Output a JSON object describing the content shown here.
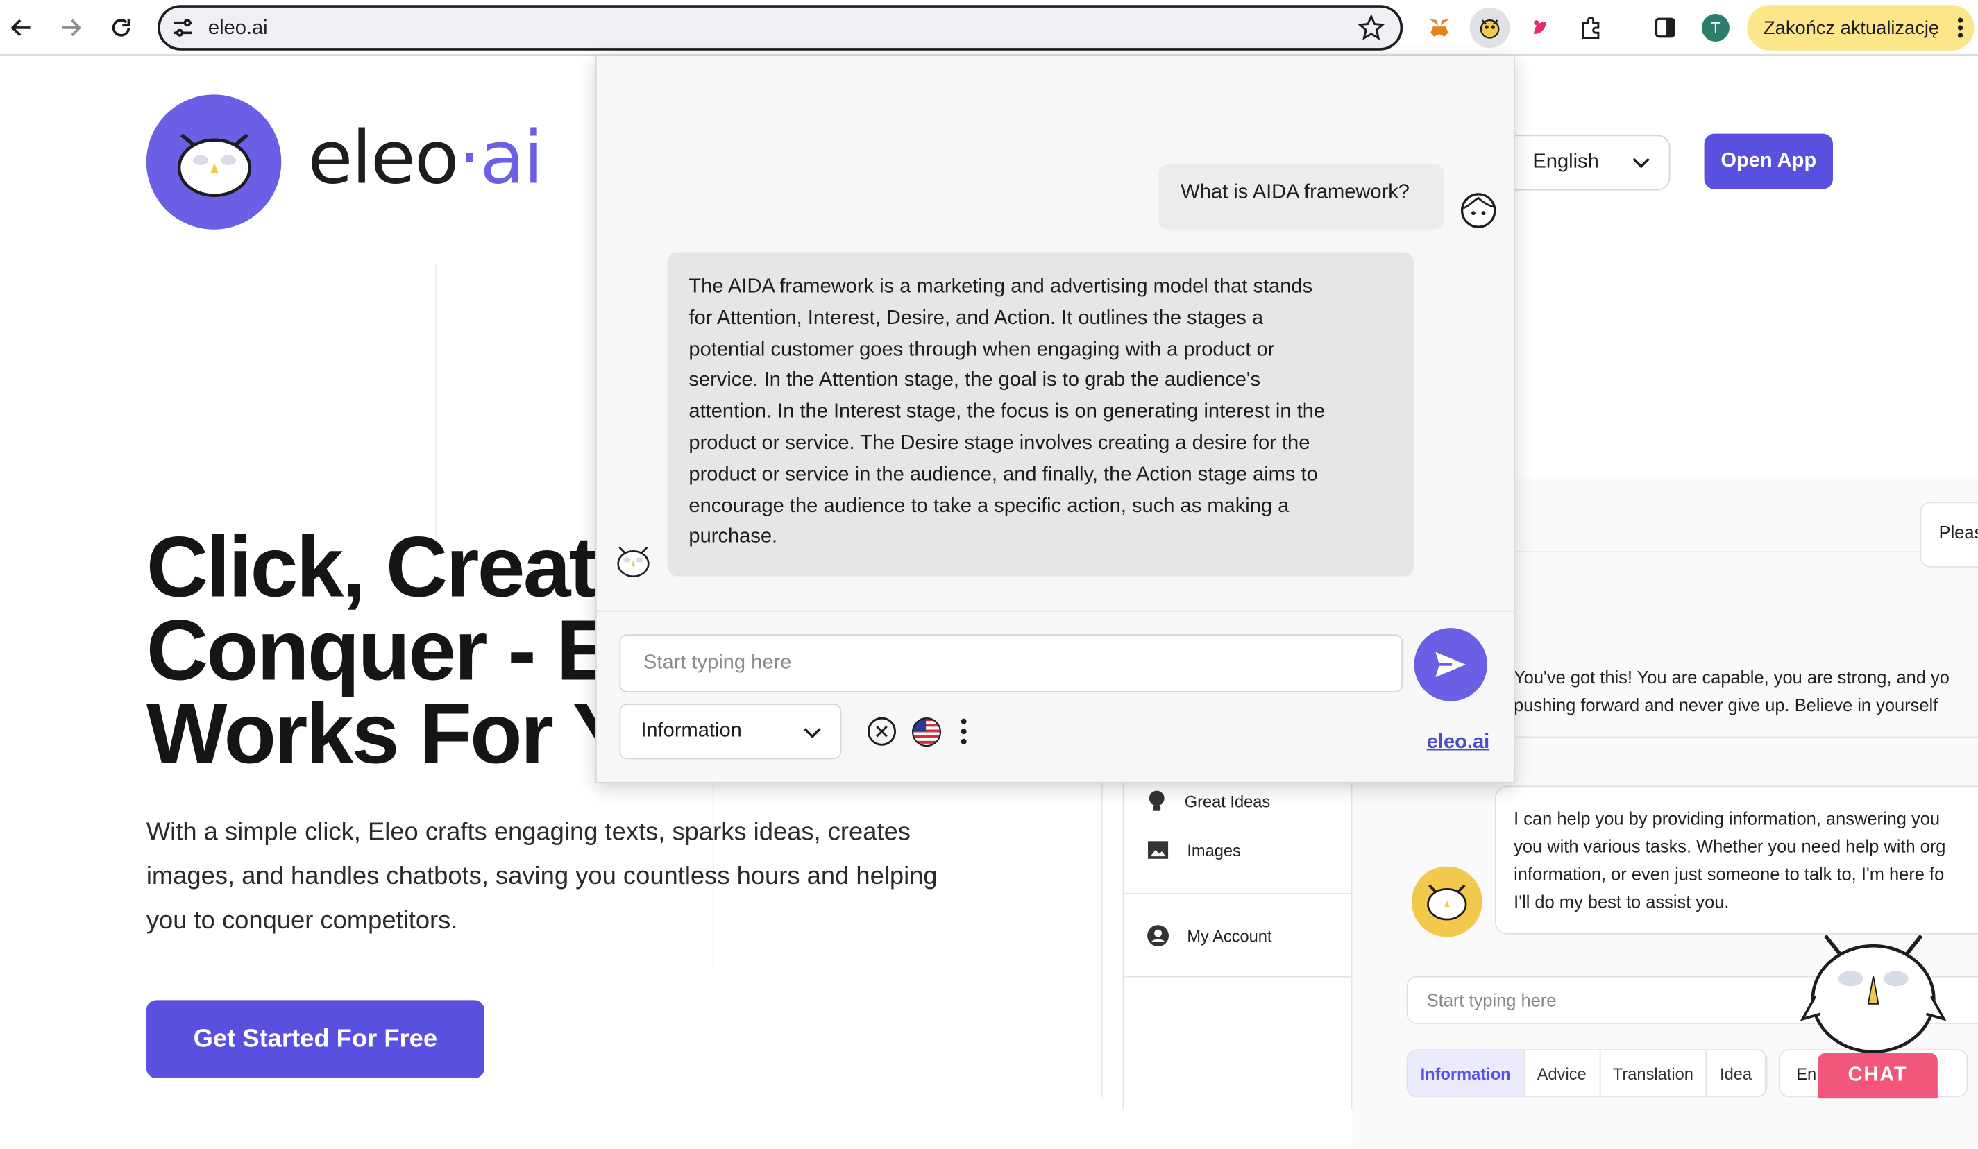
{
  "browser": {
    "url": "eleo.ai",
    "update_button": "Zakończ aktualizację",
    "profile_initial": "T"
  },
  "site": {
    "logo_text": "eleo",
    "logo_dot": "·",
    "logo_ai": "ai",
    "language": "English",
    "open_app": "Open App",
    "hero_lines": [
      "Click, Create",
      "Conquer - E",
      "Works For Yo"
    ],
    "hero_sub": "With a simple click, Eleo crafts engaging texts, sparks ideas, creates images, and handles chatbots, saving you countless hours and helping you to conquer competitors.",
    "cta": "Get Started For Free"
  },
  "preview": {
    "sidebar": [
      {
        "label": "Great Ideas",
        "icon": "lightbulb-icon"
      },
      {
        "label": "Images",
        "icon": "image-icon"
      },
      {
        "label": "My Account",
        "icon": "account-icon"
      }
    ],
    "bubble_partial": "Pleas",
    "motivation_line1": "You've got this! You are capable, you are strong, and yo",
    "motivation_line2": "pushing forward and never give up. Believe in yourself",
    "ai_reply_lines": [
      "I can help you by providing information, answering you",
      "you with various tasks. Whether you need help with org",
      "information, or even just someone to talk to, I'm here fo",
      "I'll do my best to assist you."
    ],
    "input_placeholder": "Start typing here",
    "tabs": [
      "Information",
      "Advice",
      "Translation",
      "Idea"
    ],
    "language_partial": "En",
    "chat_label": "CHAT"
  },
  "popup": {
    "user_message": "What is AIDA framework?",
    "bot_lines": [
      "The AIDA framework is a marketing and advertising model that stands",
      "for Attention, Interest, Desire, and Action. It outlines the stages a",
      "potential customer goes through when engaging with a product or",
      "service. In the Attention stage, the goal is to grab the audience's",
      "attention. In the Interest stage, the focus is on generating interest in the",
      "product or service. The Desire stage involves creating a desire for the",
      "product or service in the audience, and finally, the Action stage aims to",
      "encourage the audience to take a specific action, such as making a",
      "purchase."
    ],
    "input_placeholder": "Start typing here",
    "mode": "Information",
    "link": "eleo.ai"
  },
  "colors": {
    "brand": "#5a50e0",
    "update_pill": "#fde68a",
    "chat_tag": "#f2567a"
  }
}
